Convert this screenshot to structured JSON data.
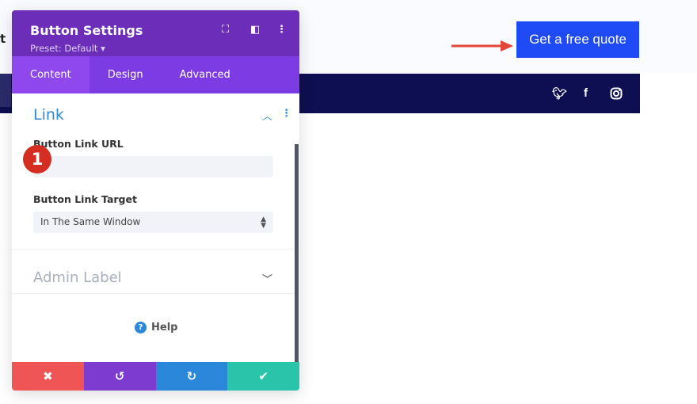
{
  "background": {
    "partial_letter": "t",
    "cta_label": "Get a free quote",
    "social_icons": [
      "twitter-icon",
      "facebook-icon",
      "instagram-icon"
    ]
  },
  "panel": {
    "title": "Button Settings",
    "preset": "Preset: Default ▾",
    "tabs": [
      {
        "label": "Content"
      },
      {
        "label": "Design"
      },
      {
        "label": "Advanced"
      }
    ],
    "link_section": {
      "title": "Link",
      "url_label": "Button Link URL",
      "url_value": "",
      "target_label": "Button Link Target",
      "target_value": "In The Same Window"
    },
    "admin_section": {
      "title": "Admin Label"
    },
    "help_label": "Help",
    "step_badge": "1",
    "footer_colors": {
      "cancel": "#ef5555",
      "undo": "#7e3bd0",
      "redo": "#2b87da",
      "save": "#29c4a9"
    }
  },
  "colors": {
    "header": "#6c2eb9",
    "tabs": "#7d3be3",
    "cta": "#1e4bf5",
    "navbar": "#0e0f52",
    "accent": "#2e8bd9"
  }
}
